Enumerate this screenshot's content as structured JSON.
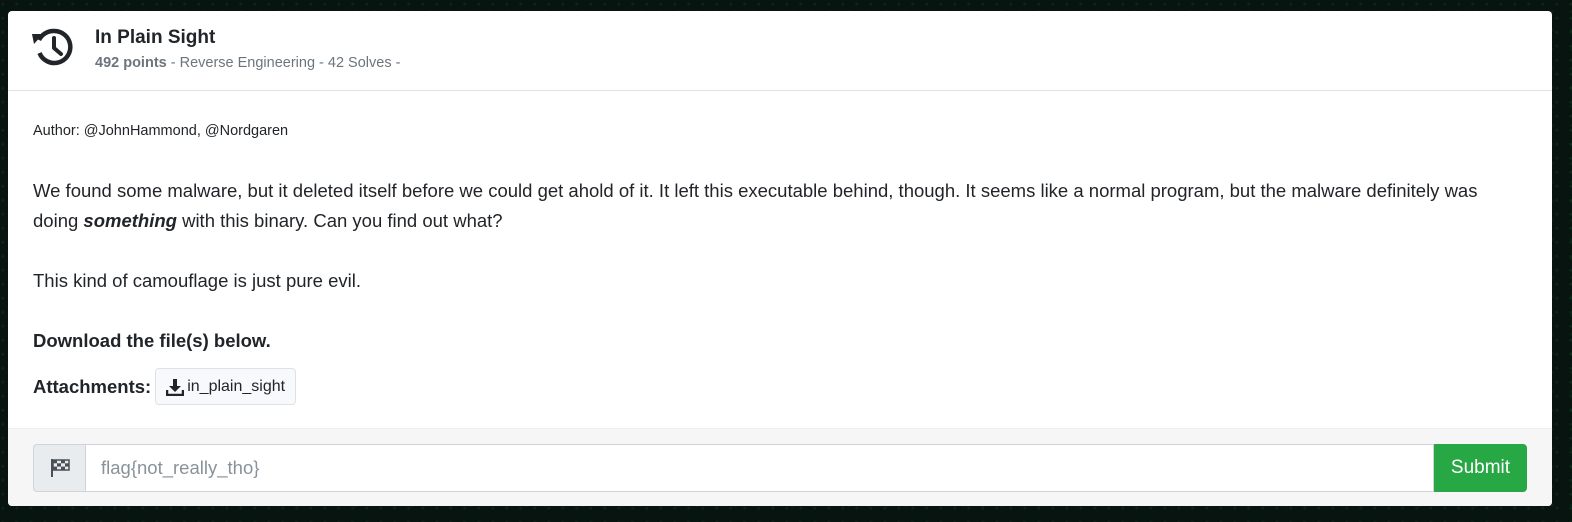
{
  "challenge": {
    "title": "In Plain Sight",
    "points": "492 points",
    "meta": " - Reverse Engineering - 42 Solves -",
    "header_icon": "history-icon"
  },
  "body": {
    "author": "Author: @JohnHammond, @Nordgaren",
    "desc_before": "We found some malware, but it deleted itself before we could get ahold of it. It left this executable behind, though. It seems like a normal program, but the malware definitely was doing ",
    "desc_emphasis": "something",
    "desc_after": " with this binary. Can you find out what?",
    "camouflage": "This kind of camouflage is just pure evil.",
    "download_note": "Download the file(s) below.",
    "attachments_label": "Attachments:",
    "attachment_name": "in_plain_sight",
    "attachment_icon": "download-icon"
  },
  "footer": {
    "flag_icon": "checkered-flag-icon",
    "flag_placeholder": "flag{not_really_tho}",
    "flag_value": "",
    "submit_label": "Submit",
    "submit_color": "#28a745"
  }
}
